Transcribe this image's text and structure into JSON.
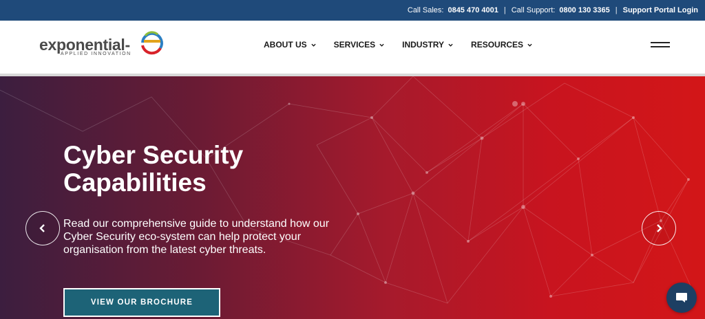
{
  "topbar": {
    "sales_label": "Call Sales:",
    "sales_number": "0845 470 4001",
    "separator": "|",
    "support_label": "Call Support:",
    "support_number": "0800 130 3365",
    "separator2": "|",
    "portal_link": "Support Portal Login"
  },
  "logo": {
    "word": "exponential-",
    "tagline": "APPLIED INNOVATION",
    "icon": "e-swirl-logo-icon"
  },
  "nav": {
    "items": [
      {
        "label": "ABOUT US",
        "icon": "chevron-down-icon"
      },
      {
        "label": "SERVICES",
        "icon": "chevron-down-icon"
      },
      {
        "label": "INDUSTRY",
        "icon": "chevron-down-icon"
      },
      {
        "label": "RESOURCES",
        "icon": "chevron-down-icon"
      }
    ],
    "menu_icon": "hamburger-menu-icon"
  },
  "hero": {
    "title": "Cyber Security Capabilities",
    "text": "Read our comprehensive guide to understand how our Cyber Security eco-system can help protect your organisation from the latest cyber threats.",
    "cta_label": "VIEW OUR BROCHURE",
    "prev_icon": "chevron-left-icon",
    "next_icon": "chevron-right-icon"
  },
  "chat": {
    "icon": "chat-bubble-icon"
  },
  "colors": {
    "topbar_bg": "#1f4a7a",
    "hero_gradient_start": "#3c1e3f",
    "hero_gradient_end": "#d31618",
    "cta_bg": "#1d6377",
    "chat_bg": "#1d3f63"
  }
}
